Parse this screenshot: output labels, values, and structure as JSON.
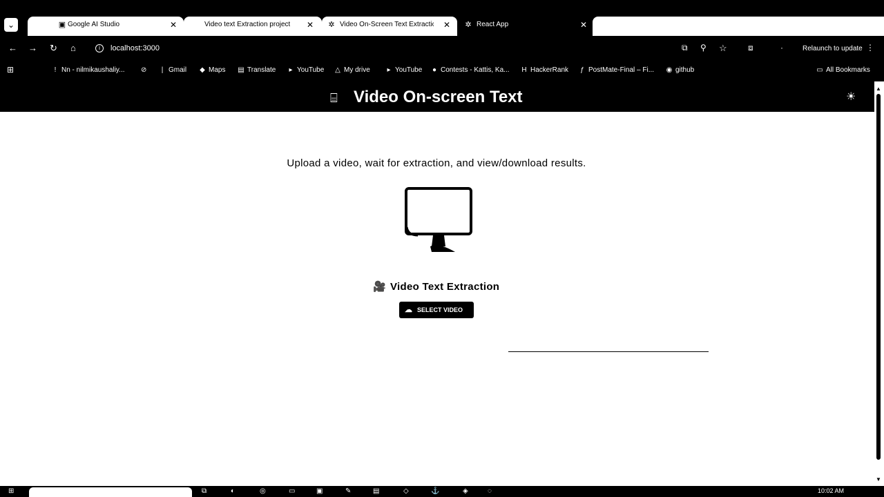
{
  "tabs": [
    {
      "title": "Google AI Studio",
      "close": "✕"
    },
    {
      "title": "Video text Extraction project",
      "close": "✕"
    },
    {
      "title": "Video On-Screen Text Extractic",
      "close": "✕"
    },
    {
      "title": "React App",
      "close": "✕"
    }
  ],
  "toolbar": {
    "url": "localhost:3000",
    "relaunch": "Relaunch to update"
  },
  "bookmarks": [
    "Nn - nilmikaushaliy...",
    "Gmail",
    "Maps",
    "Translate",
    "YouTube",
    "My drive",
    "YouTube",
    "Contests - Kattis, Ka...",
    "HackerRank",
    "PostMate-Final – Fi...",
    "github"
  ],
  "all_bookmarks": "All Bookmarks",
  "app": {
    "title": "Video On-screen Text",
    "subtitle": "Upload a video, wait for extraction, and view/download results.",
    "section_title": "Video Text Extraction",
    "select_button": "SELECT VIDEO"
  },
  "taskbar": {
    "clock": "10:02 AM"
  }
}
